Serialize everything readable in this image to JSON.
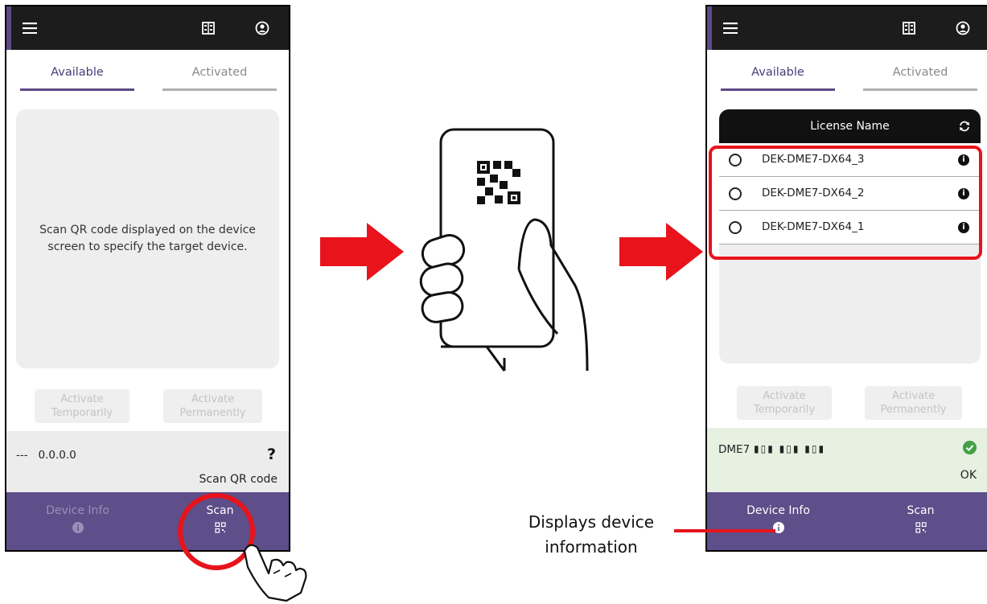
{
  "colors": {
    "accent": "#5e4e89",
    "highlight": "#e8131b",
    "ok_green": "#43a047"
  },
  "icons": {
    "menu": "menu-icon",
    "building": "building-icon",
    "account": "account-icon",
    "info": "info-icon",
    "qr": "qr-code-icon",
    "refresh": "refresh-icon",
    "check": "check-circle-icon",
    "hand": "hand-pointer-icon"
  },
  "left_screen": {
    "tabs": [
      "Available",
      "Activated"
    ],
    "empty_message": "Scan QR code displayed on the device screen to specify the target device.",
    "buttons": {
      "activate_temp_line1": "Activate",
      "activate_temp_line2": "Temporarily",
      "activate_perm_line1": "Activate",
      "activate_perm_line2": "Permanently"
    },
    "status": {
      "model": "---",
      "ip": "0.0.0.0",
      "unknown_mark": "?",
      "caption": "Scan QR code"
    },
    "nav": {
      "device_info": "Device Info",
      "scan": "Scan"
    }
  },
  "right_screen": {
    "tabs": [
      "Available",
      "Activated"
    ],
    "table_header": "License Name",
    "licenses": [
      "DEK-DME7-DX64_3",
      "DEK-DME7-DX64_2",
      "DEK-DME7-DX64_1"
    ],
    "buttons": {
      "activate_temp_line1": "Activate",
      "activate_temp_line2": "Temporarily",
      "activate_perm_line1": "Activate",
      "activate_perm_line2": "Permanently"
    },
    "status": {
      "model": "DME7",
      "serial": "▮▯▮ ▮▯▮ ▮▯▮",
      "result": "OK"
    },
    "nav": {
      "device_info": "Device Info",
      "scan": "Scan"
    }
  },
  "callout": {
    "line1": "Displays device",
    "line2": "information"
  }
}
